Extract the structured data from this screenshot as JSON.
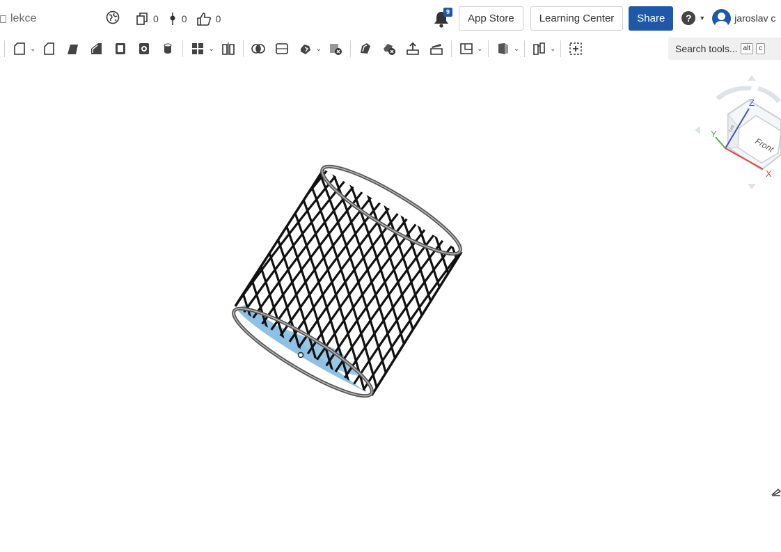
{
  "document": {
    "name": "lekce"
  },
  "stats": {
    "versions": "0",
    "branches": "0",
    "likes": "0"
  },
  "notifications": {
    "count": "9"
  },
  "header": {
    "app_store_label": "App Store",
    "learning_center_label": "Learning Center",
    "share_label": "Share",
    "help_label": "?",
    "user_name": "jaroslav c"
  },
  "toolbar": {
    "tools": [
      "sketch-icon",
      "extrude-icon",
      "revolve-icon",
      "sweep-icon",
      "loft-icon",
      "thicken-icon",
      "shell-icon",
      "cylinder-icon",
      "fillet-icon",
      "pattern-icon",
      "boolean-icon",
      "split-icon",
      "transform-icon",
      "delete-part-icon",
      "modify-fillet-icon",
      "delete-face-icon",
      "move-face-icon",
      "replace-face-icon",
      "plane-icon",
      "mate-connector-icon",
      "sheet-metal-icon",
      "add-custom-feature-icon"
    ],
    "search_label": "Search tools...",
    "search_shortcut_1": "alt",
    "search_shortcut_2": "c"
  },
  "viewcube": {
    "face_label": "Front",
    "side_label": "Left",
    "axis_x": "X",
    "axis_y": "Y",
    "axis_z": "Z"
  },
  "colors": {
    "accent": "#1e58a7",
    "axis_x": "#d9463c",
    "axis_y": "#4caf50",
    "axis_z": "#3f51b5",
    "model_face": "#8fc1e3",
    "model_lines": "#111111"
  }
}
